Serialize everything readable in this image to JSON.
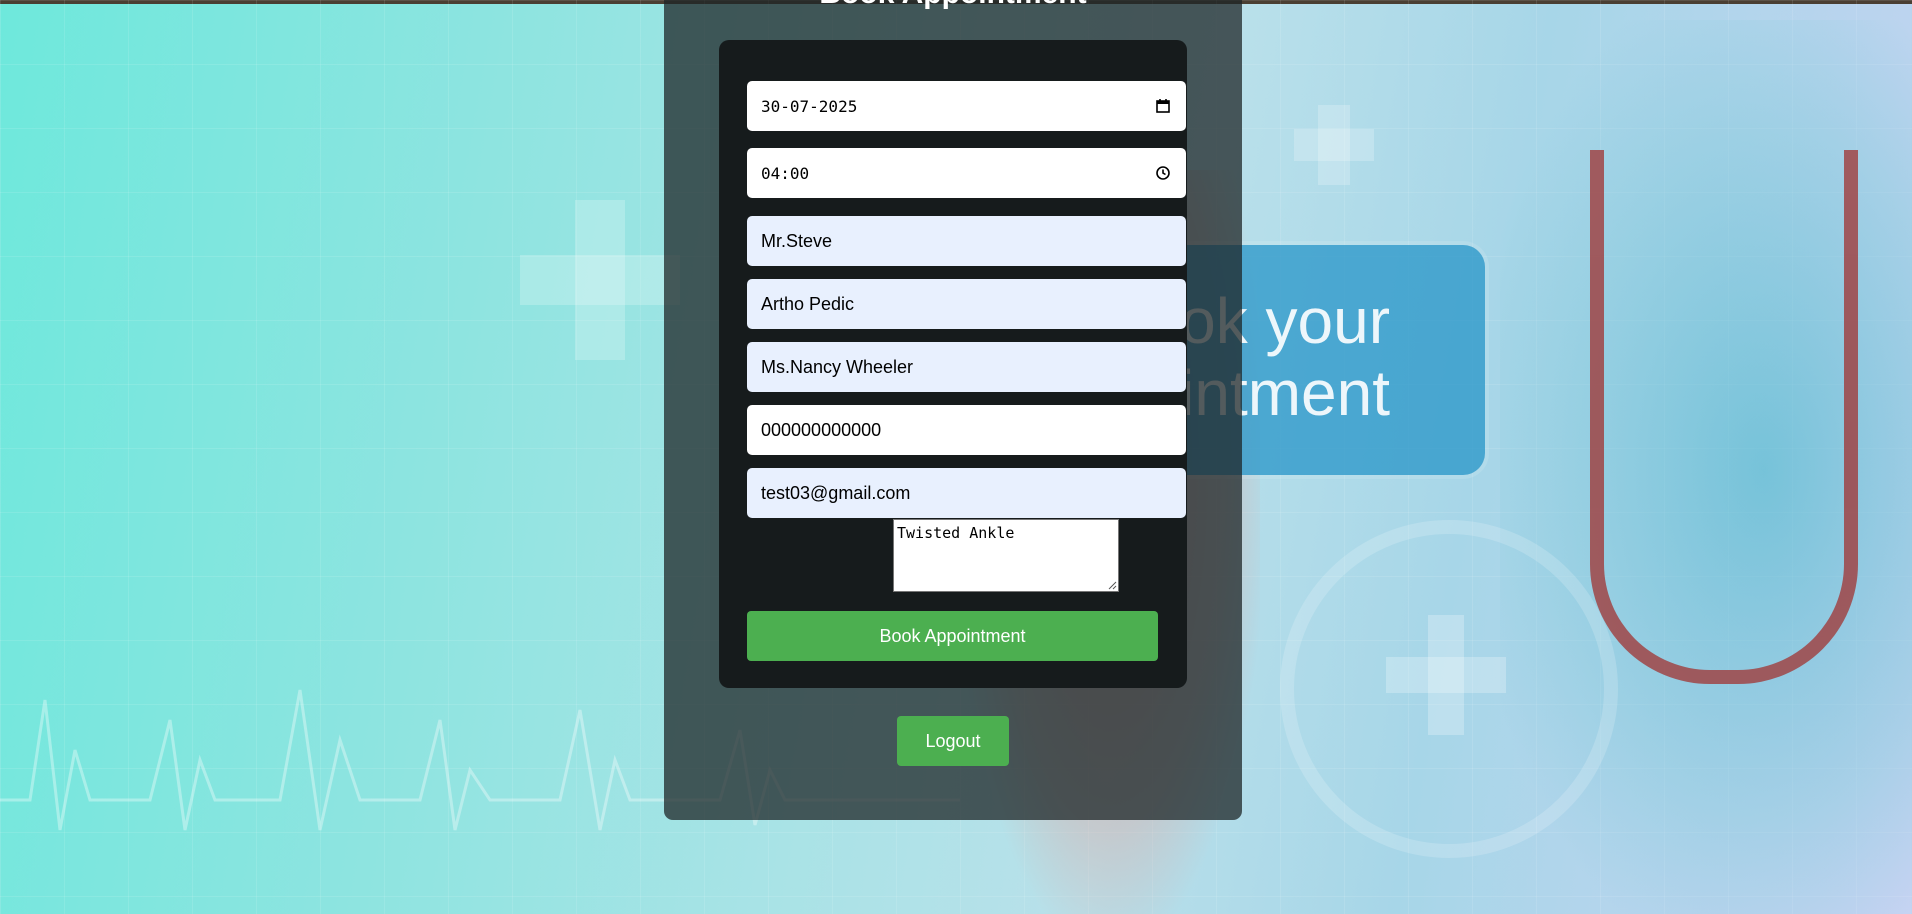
{
  "form": {
    "title": "Book Appointment",
    "date_value": "30-07-2025",
    "time_value": "04:00",
    "doctor_name": "Mr.Steve",
    "department": "Artho Pedic",
    "patient_name": "Ms.Nancy Wheeler",
    "phone": "000000000000",
    "email": "test03@gmail.com",
    "reason": "Twisted Ankle",
    "submit_label": "Book Appointment"
  },
  "logout_label": "Logout",
  "background": {
    "banner_text": "Book your appointment"
  },
  "colors": {
    "accent_green": "#4caf50",
    "autofill_blue": "#e8f0fe"
  },
  "icons": {
    "date": "calendar-icon",
    "time": "clock-icon",
    "resize": "resize-grip-icon"
  }
}
